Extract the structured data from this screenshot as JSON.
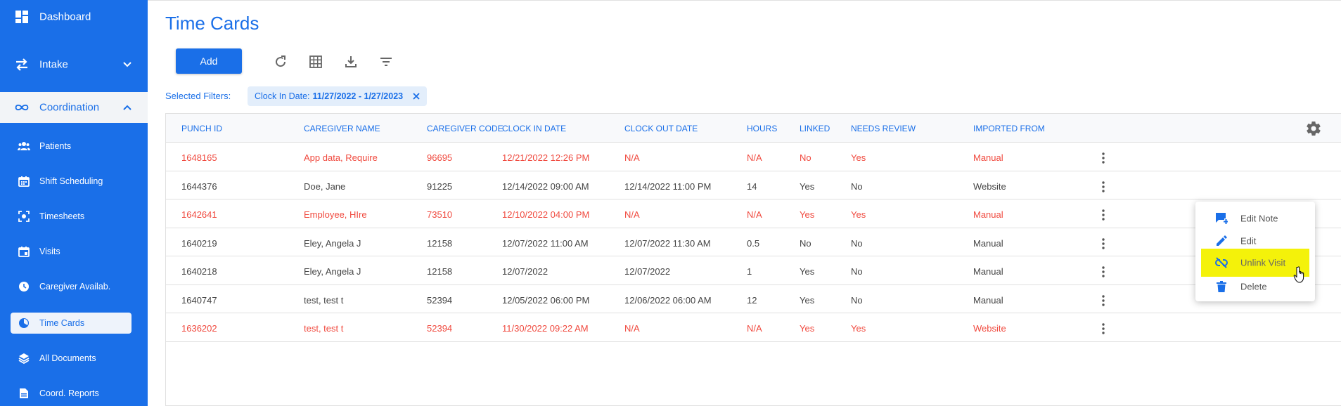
{
  "sidebar": {
    "items": [
      {
        "label": "Dashboard",
        "icon": "dashboard-icon"
      },
      {
        "label": "Intake",
        "icon": "swap-icon"
      },
      {
        "label": "Coordination",
        "icon": "infinity-icon"
      }
    ],
    "sub_items": [
      {
        "label": "Patients",
        "icon": "people-icon"
      },
      {
        "label": "Shift Scheduling",
        "icon": "calendar-icon"
      },
      {
        "label": "Timesheets",
        "icon": "timesheet-icon"
      },
      {
        "label": "Visits",
        "icon": "event-icon"
      },
      {
        "label": "Caregiver Availab.",
        "icon": "clock-icon"
      },
      {
        "label": "Time Cards",
        "icon": "timer-icon"
      },
      {
        "label": "All Documents",
        "icon": "layers-icon"
      },
      {
        "label": "Coord. Reports",
        "icon": "report-icon"
      }
    ]
  },
  "page": {
    "title": "Time Cards",
    "add_label": "Add",
    "filters_label": "Selected Filters:",
    "filter_chip": {
      "key": "Clock In Date:",
      "value": "11/27/2022 - 1/27/2023"
    }
  },
  "table": {
    "columns": [
      "PUNCH ID",
      "CAREGIVER NAME",
      "CAREGIVER CODE",
      "CLOCK IN DATE",
      "CLOCK OUT DATE",
      "HOURS",
      "LINKED",
      "NEEDS REVIEW",
      "IMPORTED FROM"
    ],
    "rows": [
      {
        "cells": [
          "1648165",
          "App data, Require",
          "96695",
          "12/21/2022 12:26 PM",
          "N/A",
          "N/A",
          "No",
          "Yes",
          "Manual"
        ],
        "alert": true
      },
      {
        "cells": [
          "1644376",
          "Doe, Jane",
          "91225",
          "12/14/2022 09:00 AM",
          "12/14/2022 11:00 PM",
          "14",
          "Yes",
          "No",
          "Website"
        ],
        "alert": false
      },
      {
        "cells": [
          "1642641",
          "Employee, HIre",
          "73510",
          "12/10/2022 04:00 PM",
          "N/A",
          "N/A",
          "Yes",
          "Yes",
          "Manual"
        ],
        "alert": true
      },
      {
        "cells": [
          "1640219",
          "Eley, Angela J",
          "12158",
          "12/07/2022 11:00 AM",
          "12/07/2022 11:30 AM",
          "0.5",
          "No",
          "No",
          "Manual"
        ],
        "alert": false
      },
      {
        "cells": [
          "1640218",
          "Eley, Angela J",
          "12158",
          "12/07/2022",
          "12/07/2022",
          "1",
          "Yes",
          "No",
          "Manual"
        ],
        "alert": false
      },
      {
        "cells": [
          "1640747",
          "test, test t",
          "52394",
          "12/05/2022 06:00 PM",
          "12/06/2022 06:00 AM",
          "12",
          "Yes",
          "No",
          "Manual"
        ],
        "alert": false
      },
      {
        "cells": [
          "1636202",
          "test, test t",
          "52394",
          "11/30/2022 09:22 AM",
          "N/A",
          "N/A",
          "Yes",
          "Yes",
          "Website"
        ],
        "alert": true
      }
    ]
  },
  "context_menu": {
    "items": [
      {
        "label": "Edit Note",
        "icon": "note-icon"
      },
      {
        "label": "Edit",
        "icon": "pencil-icon"
      },
      {
        "label": "Unlink Visit",
        "icon": "unlink-icon"
      },
      {
        "label": "Delete",
        "icon": "trash-icon"
      }
    ]
  },
  "colors": {
    "brand": "#1a6fe8",
    "alert": "#f0493e",
    "highlight": "#f4f20a"
  }
}
